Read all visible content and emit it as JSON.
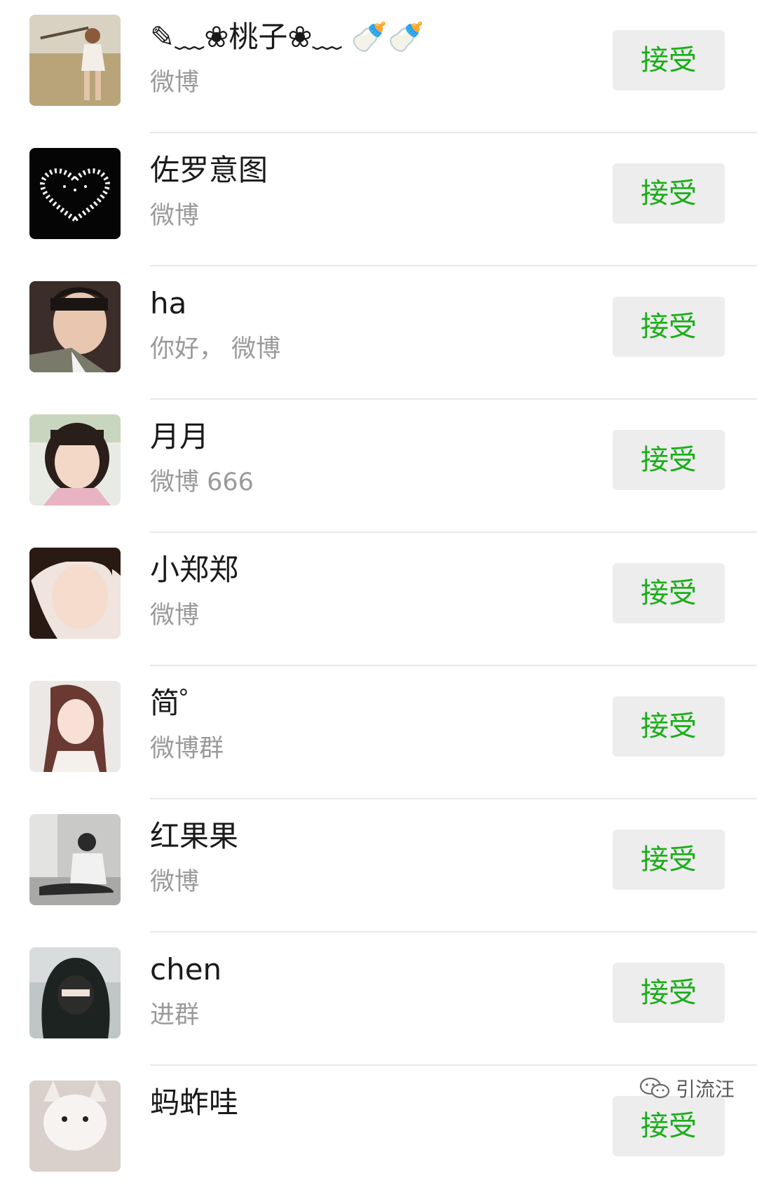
{
  "requests": [
    {
      "name": "✎﹏❀桃子❀﹏ 🍼🍼",
      "message": "微博",
      "action": "接受",
      "avatar": "avatar-girl-with-rifle"
    },
    {
      "name": "佐罗意图",
      "message": "微博",
      "action": "接受",
      "avatar": "avatar-heart-of-lights"
    },
    {
      "name": "ha",
      "message": "你好， 微博",
      "action": "接受",
      "avatar": "avatar-boy-portrait"
    },
    {
      "name": "月月",
      "message": "微博 666",
      "action": "接受",
      "avatar": "avatar-little-girl"
    },
    {
      "name": "小郑郑",
      "message": "微博",
      "action": "接受",
      "avatar": "avatar-woman-winking"
    },
    {
      "name": "简゜",
      "message": "微博群",
      "action": "接受",
      "avatar": "avatar-woman-long-hair"
    },
    {
      "name": "红果果",
      "message": "微博",
      "action": "接受",
      "avatar": "avatar-sitting-person"
    },
    {
      "name": "chen",
      "message": "进群",
      "action": "接受",
      "avatar": "avatar-hooded-figure"
    },
    {
      "name": "蚂蚱哇",
      "message": "",
      "action": "接受",
      "avatar": "avatar-white-dog"
    }
  ],
  "watermark": {
    "icon": "wechat-official-account-icon",
    "text": "引流汪"
  }
}
